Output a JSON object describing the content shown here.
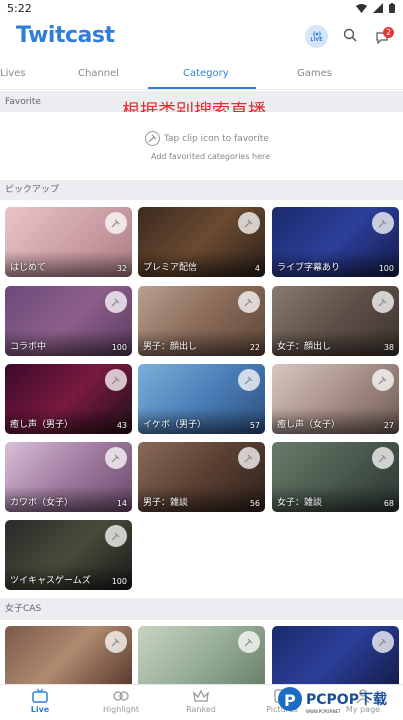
{
  "status_bar": {
    "time": "5:22"
  },
  "header": {
    "logo": "Twitcast",
    "live_label": "LIVE",
    "notification_count": "2"
  },
  "tabs": [
    {
      "label": "Lives"
    },
    {
      "label": "Channel"
    },
    {
      "label": "Category"
    },
    {
      "label": "Games"
    }
  ],
  "annotation": "根据类别搜索直播",
  "favorite": {
    "title": "Favorite",
    "hint": "Tap clip icon to favorite",
    "sub": "Add favorited categories here"
  },
  "pickup": {
    "title": "ピックアップ",
    "tiles": [
      {
        "name": "はじめて",
        "count": "32"
      },
      {
        "name": "プレミア配信",
        "count": "4"
      },
      {
        "name": "ライブ字幕あり",
        "count": "100"
      },
      {
        "name": "コラボ中",
        "count": "100"
      },
      {
        "name": "男子：顔出し",
        "count": "22"
      },
      {
        "name": "女子：顔出し",
        "count": "38"
      },
      {
        "name": "癒し声（男子）",
        "count": "43"
      },
      {
        "name": "イケボ（男子）",
        "count": "57"
      },
      {
        "name": "癒し声（女子）",
        "count": "27"
      },
      {
        "name": "カワボ（女子）",
        "count": "14"
      },
      {
        "name": "男子：雑談",
        "count": "56"
      },
      {
        "name": "女子：雑談",
        "count": "68"
      },
      {
        "name": "ツイキャスゲームズ",
        "count": "100"
      }
    ]
  },
  "joshi_cas": {
    "title": "女子CAS"
  },
  "bottom_nav": [
    {
      "label": "Live"
    },
    {
      "label": "Highlight"
    },
    {
      "label": "Ranked"
    },
    {
      "label": "Pictures"
    },
    {
      "label": "My page"
    }
  ],
  "watermark": {
    "brand": "PCPOP下载",
    "sub": "WWW.PCPOP.NET"
  },
  "colors": {
    "accent": "#2f7fd9",
    "badge": "#e53935",
    "annotation": "#e52b2b"
  }
}
